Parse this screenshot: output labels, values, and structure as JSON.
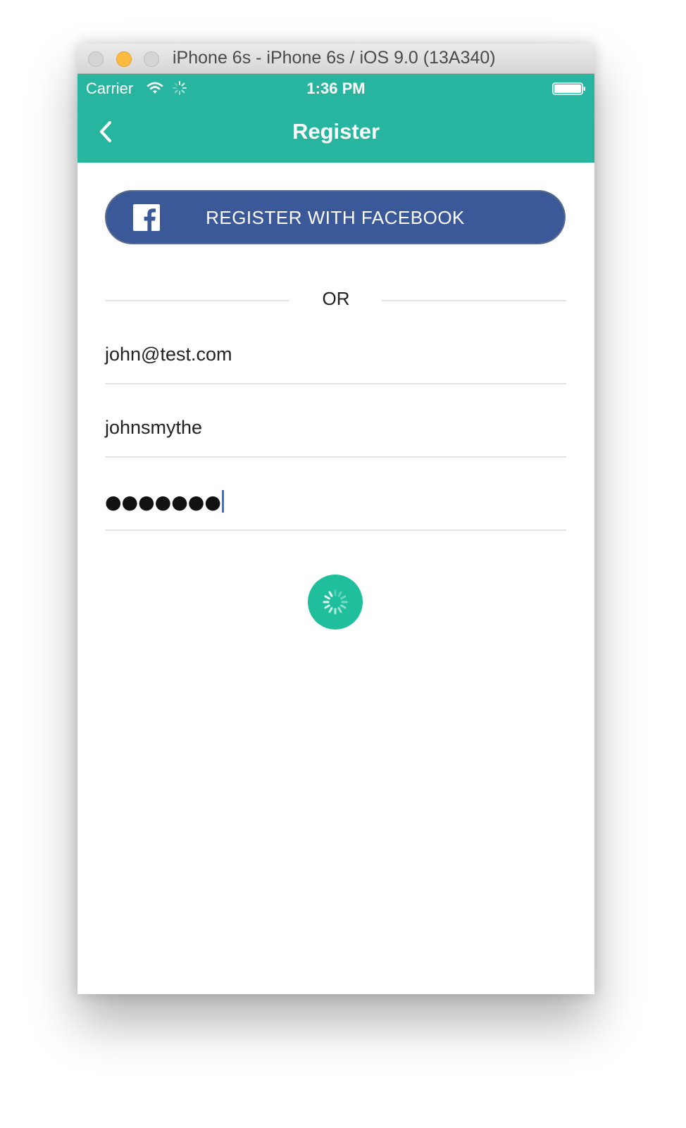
{
  "window": {
    "title": "iPhone 6s - iPhone 6s / iOS 9.0 (13A340)"
  },
  "status_bar": {
    "carrier": "Carrier",
    "time": "1:36 PM"
  },
  "nav": {
    "title": "Register",
    "back_icon": "chevron-left-icon"
  },
  "facebook_button": {
    "label": "REGISTER WITH FACEBOOK",
    "icon": "facebook-icon"
  },
  "divider": {
    "label": "OR"
  },
  "form": {
    "email_value": "john@test.com",
    "username_value": "johnsmythe",
    "password_mask": "●●●●●●●"
  },
  "submit": {
    "state": "loading",
    "icon": "spinner-icon"
  },
  "colors": {
    "header": "#27b59f",
    "facebook": "#3b5998",
    "submit": "#1fbf9e",
    "caret": "#3c6ee0"
  }
}
